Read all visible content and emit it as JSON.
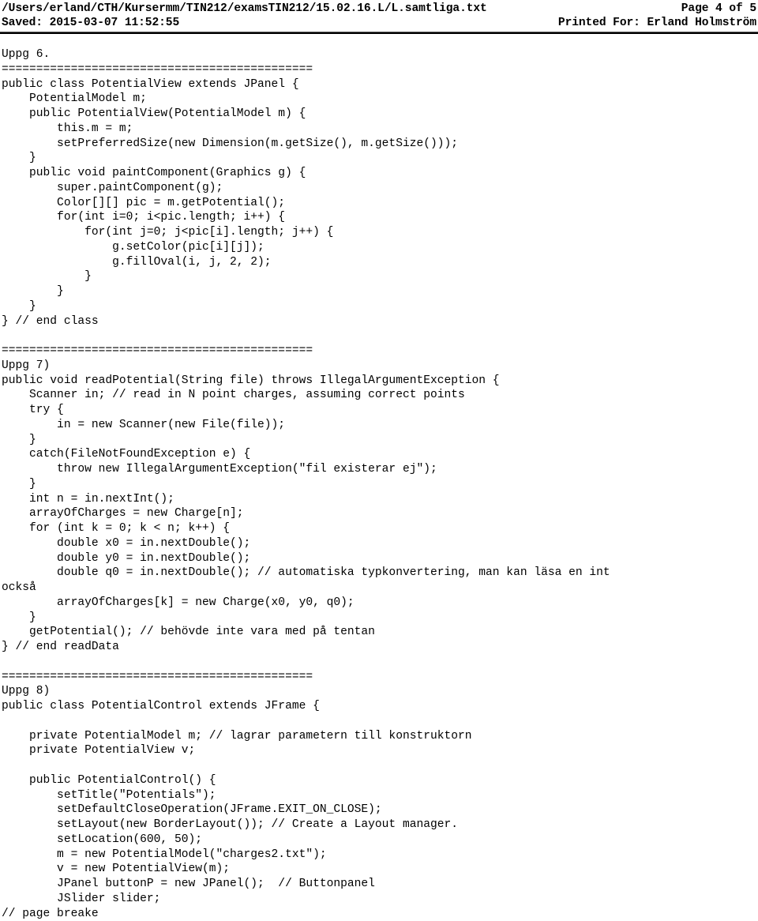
{
  "header": {
    "file_path": "/Users/erland/CTH/Kursermm/TIN212/examsTIN212/15.02.16.L/L.samtliga.txt",
    "page_label": "Page 4 of 5",
    "saved_label": "Saved: 2015-03-07 11:52:55",
    "printed_for": "Printed For: Erland Holmström"
  },
  "document": {
    "lines": [
      "Uppg 6.",
      "=============================================",
      "public class PotentialView extends JPanel {",
      "    PotentialModel m;",
      "    public PotentialView(PotentialModel m) {",
      "        this.m = m;",
      "        setPreferredSize(new Dimension(m.getSize(), m.getSize()));",
      "    }",
      "    public void paintComponent(Graphics g) {",
      "        super.paintComponent(g);",
      "        Color[][] pic = m.getPotential();",
      "        for(int i=0; i<pic.length; i++) {",
      "            for(int j=0; j<pic[i].length; j++) {",
      "                g.setColor(pic[i][j]);",
      "                g.fillOval(i, j, 2, 2);",
      "            }",
      "        }",
      "    }",
      "} // end class",
      "",
      "=============================================",
      "Uppg 7)",
      "public void readPotential(String file) throws IllegalArgumentException {",
      "    Scanner in; // read in N point charges, assuming correct points",
      "    try {",
      "        in = new Scanner(new File(file));",
      "    }",
      "    catch(FileNotFoundException e) {",
      "        throw new IllegalArgumentException(\"fil existerar ej\");",
      "    }",
      "    int n = in.nextInt();",
      "    arrayOfCharges = new Charge[n];",
      "    for (int k = 0; k < n; k++) {",
      "        double x0 = in.nextDouble();",
      "        double y0 = in.nextDouble();",
      "        double q0 = in.nextDouble(); // automatiska typkonvertering, man kan läsa en int",
      "också",
      "        arrayOfCharges[k] = new Charge(x0, y0, q0);",
      "    }",
      "    getPotential(); // behövde inte vara med på tentan",
      "} // end readData",
      "",
      "=============================================",
      "Uppg 8)",
      "public class PotentialControl extends JFrame {",
      "",
      "    private PotentialModel m; // lagrar parametern till konstruktorn",
      "    private PotentialView v;",
      "",
      "    public PotentialControl() {",
      "        setTitle(\"Potentials\");",
      "        setDefaultCloseOperation(JFrame.EXIT_ON_CLOSE);",
      "        setLayout(new BorderLayout()); // Create a Layout manager.",
      "        setLocation(600, 50);",
      "        m = new PotentialModel(\"charges2.txt\");",
      "        v = new PotentialView(m);",
      "        JPanel buttonP = new JPanel();  // Buttonpanel",
      "        JSlider slider;",
      "// page breake"
    ]
  }
}
